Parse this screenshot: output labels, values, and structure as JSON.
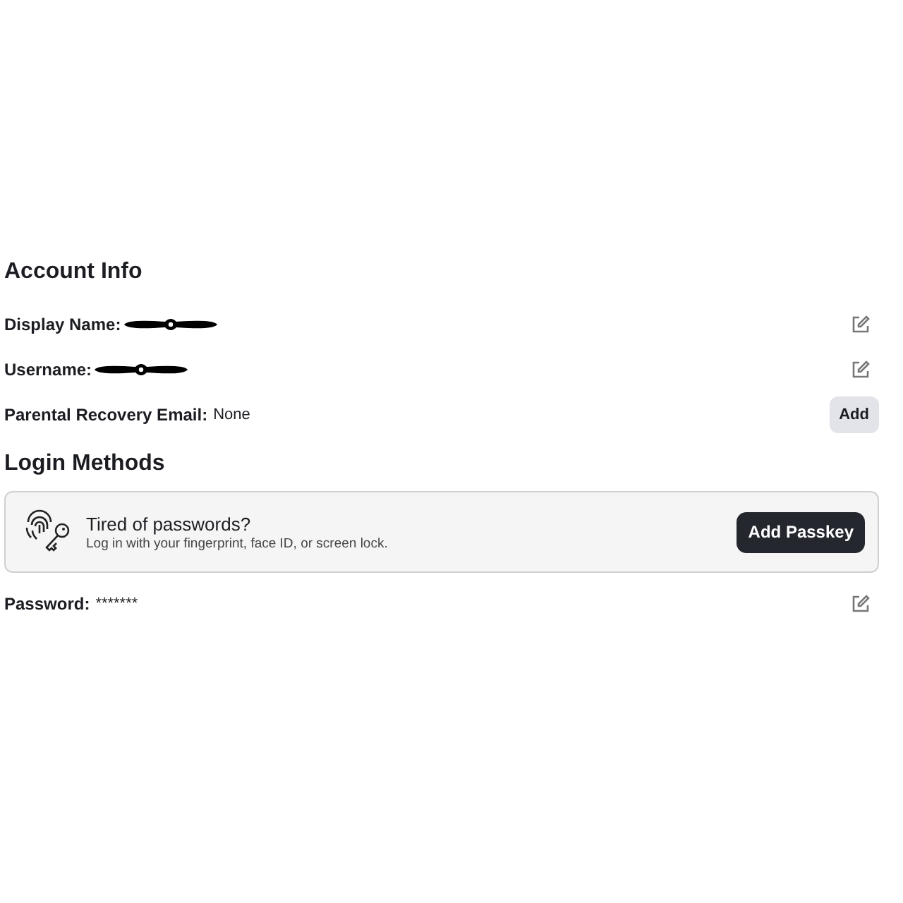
{
  "account_info": {
    "title": "Account Info",
    "rows": [
      {
        "kind": "edit",
        "label": "Display Name:",
        "redacted": true
      },
      {
        "kind": "edit",
        "label": "Username:",
        "redacted": true
      },
      {
        "kind": "add",
        "label": "Parental Recovery Email:",
        "value": "None",
        "redacted": false,
        "action_label": "Add"
      }
    ]
  },
  "login_methods": {
    "title": "Login Methods",
    "passkey_card": {
      "title": "Tired of passwords?",
      "subtitle": "Log in with your fingerprint, face ID, or screen lock.",
      "button": "Add Passkey"
    },
    "rows": [
      {
        "kind": "edit",
        "label": "Password:",
        "value": "*******",
        "redacted": false
      }
    ]
  }
}
